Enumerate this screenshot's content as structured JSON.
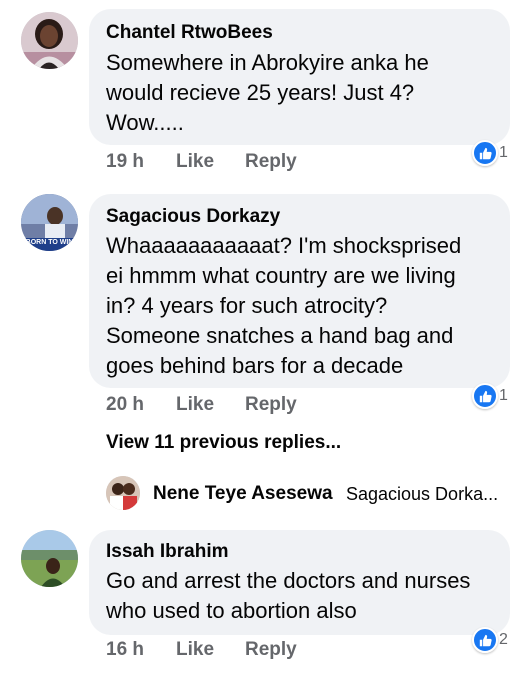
{
  "comments": [
    {
      "author": "Chantel RtwoBees",
      "lines": [
        "Somewhere in Abrokyire anka he",
        "would recieve 25 years! Just 4?",
        "Wow....."
      ],
      "time": "19 h",
      "like_label": "Like",
      "reply_label": "Reply",
      "reaction_count": "1"
    },
    {
      "author": "Sagacious Dorkazy",
      "avatar_caption": "BORN TO WIN",
      "lines": [
        "Whaaaaaaaaaaat? I'm shocksprised",
        "ei hmmm what country are we living",
        "in? 4 years for such atrocity?",
        "Someone snatches a hand bag and",
        "goes behind bars for a decade"
      ],
      "time": "20 h",
      "like_label": "Like",
      "reply_label": "Reply",
      "reaction_count": "1"
    },
    {
      "author": "Issah Ibrahim",
      "lines": [
        "Go and arrest the doctors and nurses",
        "who used to abortion also"
      ],
      "time": "16 h",
      "like_label": "Like",
      "reply_label": "Reply",
      "reaction_count": "2"
    }
  ],
  "view_replies": "View 11 previous replies...",
  "latest_reply": {
    "author": "Nene Teye Asesewa",
    "snippet": "Sagacious Dorka..."
  }
}
